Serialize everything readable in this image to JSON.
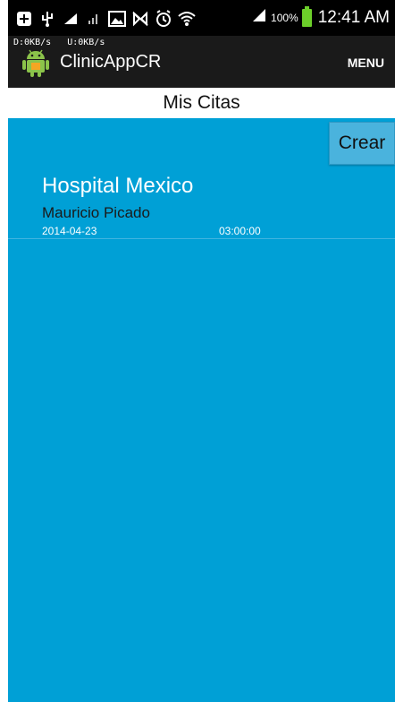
{
  "status_bar": {
    "icons": [
      "plus-square-icon",
      "usb-icon",
      "cleaner-icon",
      "signal-bars-icon",
      "image-icon",
      "nfc-off-icon",
      "alarm-icon",
      "wifi-icon",
      "cell-signal-icon"
    ],
    "battery_percent": "100%",
    "time": "12:41 AM"
  },
  "action_bar": {
    "net_speed": "D:0KB/s   U:0KB/s",
    "app_name": "ClinicAppCR",
    "menu_label": "MENU"
  },
  "page": {
    "title": "Mis Citas",
    "create_label": "Crear"
  },
  "appointments": [
    {
      "hospital": "Hospital Mexico",
      "doctor": "Mauricio Picado",
      "date": "2014-04-23",
      "time": "03:00:00"
    }
  ],
  "colors": {
    "content_bg": "#00a0d6",
    "action_bar_bg": "#1a1a1a",
    "battery": "#6ccf2a"
  }
}
